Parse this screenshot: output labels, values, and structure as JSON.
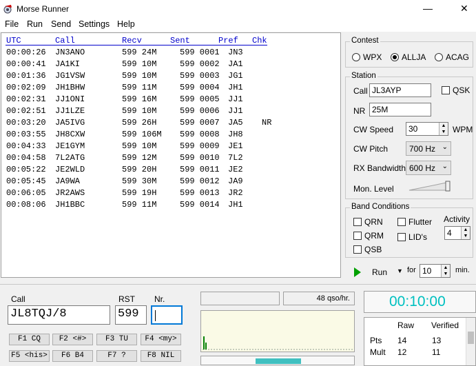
{
  "window": {
    "title": "Morse Runner",
    "minimize": "—",
    "close": "✕"
  },
  "menu": [
    "File",
    "Run",
    "Send",
    "Settings",
    "Help"
  ],
  "log": {
    "headers": {
      "utc": "UTC",
      "call": "Call",
      "recv": "Recv",
      "sent": "Sent",
      "pref": "Pref",
      "chk": "Chk"
    },
    "rows": [
      {
        "utc": "00:00:26",
        "call": "JN3ANO",
        "recv": "599 24M",
        "sent": "599 0001",
        "pref": "JN3",
        "chk": ""
      },
      {
        "utc": "00:00:41",
        "call": "JA1KI",
        "recv": "599 10M",
        "sent": "599 0002",
        "pref": "JA1",
        "chk": ""
      },
      {
        "utc": "00:01:36",
        "call": "JG1VSW",
        "recv": "599 10M",
        "sent": "599 0003",
        "pref": "JG1",
        "chk": ""
      },
      {
        "utc": "00:02:09",
        "call": "JH1BHW",
        "recv": "599 11M",
        "sent": "599 0004",
        "pref": "JH1",
        "chk": ""
      },
      {
        "utc": "00:02:31",
        "call": "JJ1ONI",
        "recv": "599 16M",
        "sent": "599 0005",
        "pref": "JJ1",
        "chk": ""
      },
      {
        "utc": "00:02:51",
        "call": "JJ1LZE",
        "recv": "599 10M",
        "sent": "599 0006",
        "pref": "JJ1",
        "chk": ""
      },
      {
        "utc": "00:03:20",
        "call": "JA5IVG",
        "recv": "599 26H",
        "sent": "599 0007",
        "pref": "JA5",
        "chk": "NR"
      },
      {
        "utc": "00:03:55",
        "call": "JH8CXW",
        "recv": "599 106M",
        "sent": "599 0008",
        "pref": "JH8",
        "chk": ""
      },
      {
        "utc": "00:04:33",
        "call": "JE1GYM",
        "recv": "599 10M",
        "sent": "599 0009",
        "pref": "JE1",
        "chk": ""
      },
      {
        "utc": "00:04:58",
        "call": "7L2ATG",
        "recv": "599 12M",
        "sent": "599 0010",
        "pref": "7L2",
        "chk": ""
      },
      {
        "utc": "00:05:22",
        "call": "JE2WLD",
        "recv": "599 20H",
        "sent": "599 0011",
        "pref": "JE2",
        "chk": ""
      },
      {
        "utc": "00:05:45",
        "call": "JA9WA",
        "recv": "599 30M",
        "sent": "599 0012",
        "pref": "JA9",
        "chk": ""
      },
      {
        "utc": "00:06:05",
        "call": "JR2AWS",
        "recv": "599 19H",
        "sent": "599 0013",
        "pref": "JR2",
        "chk": ""
      },
      {
        "utc": "00:08:06",
        "call": "JH1BBC",
        "recv": "599 11M",
        "sent": "599 0014",
        "pref": "JH1",
        "chk": ""
      }
    ]
  },
  "contest": {
    "label": "Contest",
    "options": [
      "WPX",
      "ALLJA",
      "ACAG"
    ],
    "selected": "ALLJA"
  },
  "station": {
    "label": "Station",
    "call_label": "Call",
    "call_value": "JL3AYP",
    "qsk_label": "QSK",
    "nr_label": "NR",
    "nr_value": "25M",
    "cw_speed_label": "CW Speed",
    "cw_speed_value": "30",
    "wpm_label": "WPM",
    "cw_pitch_label": "CW Pitch",
    "cw_pitch_value": "700 Hz",
    "rx_bw_label": "RX Bandwidth",
    "rx_bw_value": "600 Hz",
    "mon_level_label": "Mon. Level"
  },
  "band": {
    "label": "Band Conditions",
    "qrn": "QRN",
    "flutter": "Flutter",
    "qrm": "QRM",
    "lids": "LID's",
    "qsb": "QSB",
    "activity_label": "Activity",
    "activity_value": "4"
  },
  "run": {
    "label": "Run",
    "for_label": "for",
    "minutes_value": "10",
    "min_label": "min."
  },
  "entry": {
    "call_label": "Call",
    "call_value": "JL8TQJ/8",
    "rst_label": "RST",
    "rst_value": "599",
    "nr_label": "Nr.",
    "nr_value": ""
  },
  "fkeys": [
    "F1 CQ",
    "F2 <#>",
    "F3 TU",
    "F4 <my>",
    "F5 <his>",
    "F6 B4",
    "F7 ?",
    "F8 NIL"
  ],
  "status": {
    "rate": "48 qso/hr."
  },
  "clock": {
    "time": "00:10:00",
    "color": "#00c0c0"
  },
  "score": {
    "headers": [
      "Raw",
      "Verified"
    ],
    "rows": [
      {
        "label": "Pts",
        "raw": "14",
        "verified": "13"
      },
      {
        "label": "Mult",
        "raw": "12",
        "verified": "11"
      }
    ]
  }
}
